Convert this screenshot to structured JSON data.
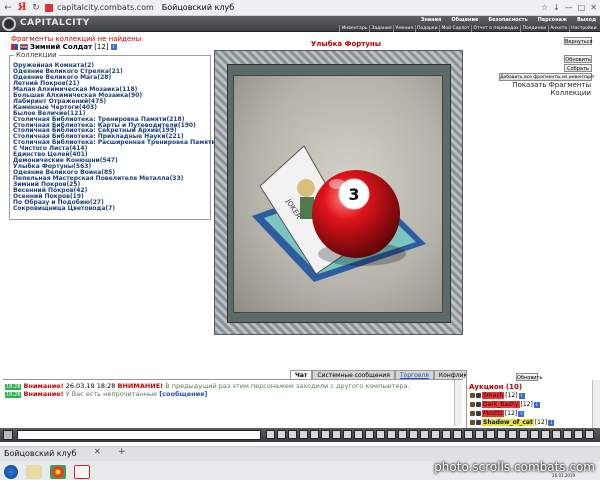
{
  "browser": {
    "url": "capitalcity.combats.com",
    "title": "Бойцовский клуб"
  },
  "header": {
    "logo": "CAPITALCITY",
    "nav_top": [
      "Знания",
      "Общение",
      "Безопасность",
      "Персонаж",
      "Выход"
    ],
    "nav_bottom": [
      "Инвентарь",
      "Задания",
      "Умения",
      "Подарки",
      "Мой Сорлот",
      "Отчет о переводах",
      "Поединки",
      "Анкета",
      "Настройки"
    ]
  },
  "notice": "Фрагменты коллекций не найдены",
  "player": {
    "name": "Зимний Солдат",
    "level": "[12]",
    "info": "i"
  },
  "collections": {
    "legend": "Коллекции",
    "items": [
      "Оружейная Комната(2)",
      "Одеяние Великого Стрелка(21)",
      "Одеяние Великого Мага(28)",
      "Летний Покров(21)",
      "Малая Алхимическая Мозаика(118)",
      "Большая Алхимическая Мозаика(90)",
      "Лабиринт Отражений(475)",
      "Каменные Чертоги(403)",
      "Былое Величие(121)",
      "Столичная Библиотека: Тренировка Памяти(218)",
      "Столичная Библиотека: Карты и Путеводители(190)",
      "Столичная Библиотека: Секретный Архив(199)",
      "Столичная Библиотека: Прикладные Науки(221)",
      "Столичная Библиотека: Расширенная Тренировка Памяти(196)",
      "С Чистого Листа(414)",
      "Единство Целей(401)",
      "Демонические Конюшни(547)",
      "Улыбка Фортуны(563)",
      "Одеяние Великого Воина(85)",
      "Пепельная Мастерская Повелителя Металла(33)",
      "Зимний Покров(25)",
      "Весенний Покров(42)",
      "Осенний Покров(19)",
      "По Образу и Подобию(27)",
      "Сокровищница Цветовода(7)"
    ]
  },
  "center": {
    "title": "Улыбка Фортуны",
    "card_text": "JOKER",
    "ball_number": "3"
  },
  "right": {
    "back_label": "Вернуться",
    "refresh_label": "Обновить",
    "collect_label": "Собрать",
    "add_all_label": "Добавить все фрагменты из инвентаря",
    "show_fragments": "Показать Фрагменты",
    "collections": "Коллекции"
  },
  "chat": {
    "tabs": [
      "Чат",
      "Системные сообщения",
      "Торговля",
      "Конфликты"
    ],
    "messages": [
      {
        "time": "18:28",
        "warning": "Внимание!",
        "date": "26.03.19 18:28",
        "title": "ВНИМАНИЕ!",
        "text": "В предыдущий раз этим персонажем заходили с другого компьютера."
      },
      {
        "time": "18:28",
        "warning": "Внимание!",
        "text": "У Вас есть непрочитанные",
        "link": "[сообщения]"
      }
    ]
  },
  "auction": {
    "refresh_label": "Обновить",
    "title": "Аукцион (10)",
    "rows": [
      {
        "name": "Smash",
        "level": "[12]"
      },
      {
        "name": "Dark_Bashy",
        "level": "[12]"
      },
      {
        "name": "Mosttz",
        "level": "[12]"
      },
      {
        "name": "Shadow_of_cat",
        "level": "[12]"
      }
    ]
  },
  "taskbar": {
    "tab_title": "Бойцовский клуб",
    "watermark": "photo.scrolls.combats.com",
    "date": "26.03.2019"
  }
}
